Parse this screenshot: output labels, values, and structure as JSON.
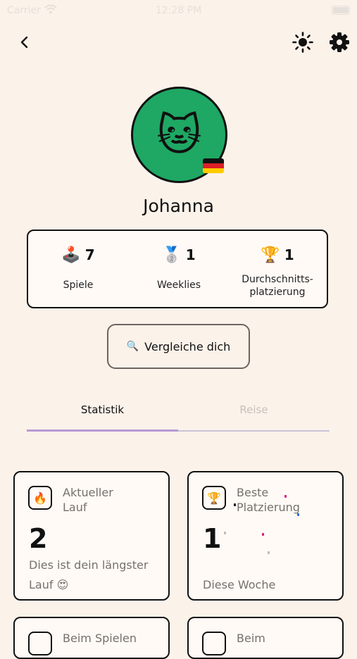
{
  "status_bar": {
    "carrier": "Carrier",
    "time": "12:28 PM"
  },
  "header": {
    "back_icon": "chevron-left-icon",
    "theme_icon": "sun-icon",
    "settings_icon": "gear-icon"
  },
  "profile": {
    "avatar_emoji": "🐱",
    "avatar_color": "#1ea864",
    "flag": "germany-flag",
    "name": "Johanna"
  },
  "stats": [
    {
      "emoji": "🕹️",
      "value": "7",
      "label": "Spiele"
    },
    {
      "emoji": "🥈",
      "value": "1",
      "label": "Weeklies"
    },
    {
      "emoji": "🏆",
      "value": "1",
      "label_line1": "Durchschnitts-",
      "label_line2": "platzierung"
    }
  ],
  "compare_button": {
    "emoji": "🔍",
    "label": "Vergleiche dich"
  },
  "tabs": [
    {
      "label": "Statistik",
      "active": true
    },
    {
      "label": "Reise",
      "active": false
    }
  ],
  "cards": [
    {
      "emoji": "🔥",
      "title_line1": "Aktueller",
      "title_line2": "Lauf",
      "value": "2",
      "desc_line1": "Dies ist dein längster",
      "desc_line2": "Lauf 😍"
    },
    {
      "emoji": "🏆",
      "title_line1": "Beste",
      "title_line2": "Platzierung",
      "value": "1",
      "desc": "Diese Woche"
    },
    {
      "title_partial": "Beim Spielen"
    },
    {
      "title_partial": "Beim"
    }
  ],
  "colors": {
    "background": "#fbf2ea",
    "accent_tab": "#b79ad6",
    "muted_text": "#77706b"
  }
}
